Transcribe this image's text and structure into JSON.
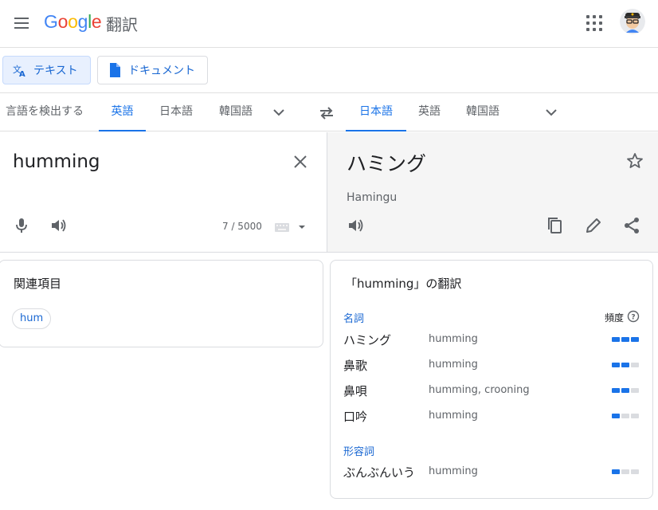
{
  "header": {
    "logo_letters": [
      {
        "ch": "G",
        "color": "#4285F4"
      },
      {
        "ch": "o",
        "color": "#EA4335"
      },
      {
        "ch": "o",
        "color": "#FBBC05"
      },
      {
        "ch": "g",
        "color": "#4285F4"
      },
      {
        "ch": "l",
        "color": "#34A853"
      },
      {
        "ch": "e",
        "color": "#EA4335"
      }
    ],
    "product": "翻訳"
  },
  "modes": {
    "text_label": "テキスト",
    "document_label": "ドキュメント"
  },
  "source_langs": {
    "detect": "言語を検出する",
    "tab1": "英語",
    "tab2": "日本語",
    "tab3": "韓国語",
    "selected": "英語"
  },
  "target_langs": {
    "tab1": "日本語",
    "tab2": "英語",
    "tab3": "韓国語",
    "selected": "日本語"
  },
  "source": {
    "text": "humming",
    "char_count": "7 / 5000"
  },
  "target": {
    "text": "ハミング",
    "romanization": "Hamingu"
  },
  "related": {
    "title": "関連項目",
    "chips": [
      "hum"
    ]
  },
  "dictionary": {
    "title": "「humming」の翻訳",
    "frequency_label": "頻度",
    "groups": [
      {
        "pos": "名詞",
        "entries": [
          {
            "term": "ハミング",
            "reverse": "humming",
            "frequency": 3
          },
          {
            "term": "鼻歌",
            "reverse": "humming",
            "frequency": 2
          },
          {
            "term": "鼻唄",
            "reverse": "humming, crooning",
            "frequency": 2
          },
          {
            "term": "口吟",
            "reverse": "humming",
            "frequency": 1
          }
        ]
      },
      {
        "pos": "形容詞",
        "entries": [
          {
            "term": "ぶんぶんいう",
            "reverse": "humming",
            "frequency": 1
          }
        ]
      }
    ]
  },
  "colors": {
    "accent": "#1a73e8",
    "active_mode_bg": "#e8f0fe",
    "target_panel_bg": "#f5f5f5"
  }
}
